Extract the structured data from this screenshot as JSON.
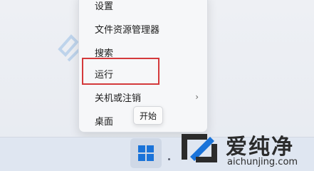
{
  "context_menu": {
    "items": [
      {
        "label": "设置"
      },
      {
        "label": "文件资源管理器"
      },
      {
        "label": "搜索"
      },
      {
        "label": "运行"
      },
      {
        "label": "关机或注销",
        "submenu_indicator": "›"
      },
      {
        "label": "桌面"
      }
    ],
    "highlighted_item": "运行"
  },
  "tooltip": {
    "text": "开始"
  },
  "taskbar": {
    "start_icon": "windows-logo-icon"
  },
  "watermark": {
    "brand_name": "爱纯净",
    "domain": "aichunjing.com"
  },
  "colors": {
    "highlight_border": "#d4393b",
    "windows_blue": "#1a73d9",
    "brand_text": "#2b2b2b"
  }
}
